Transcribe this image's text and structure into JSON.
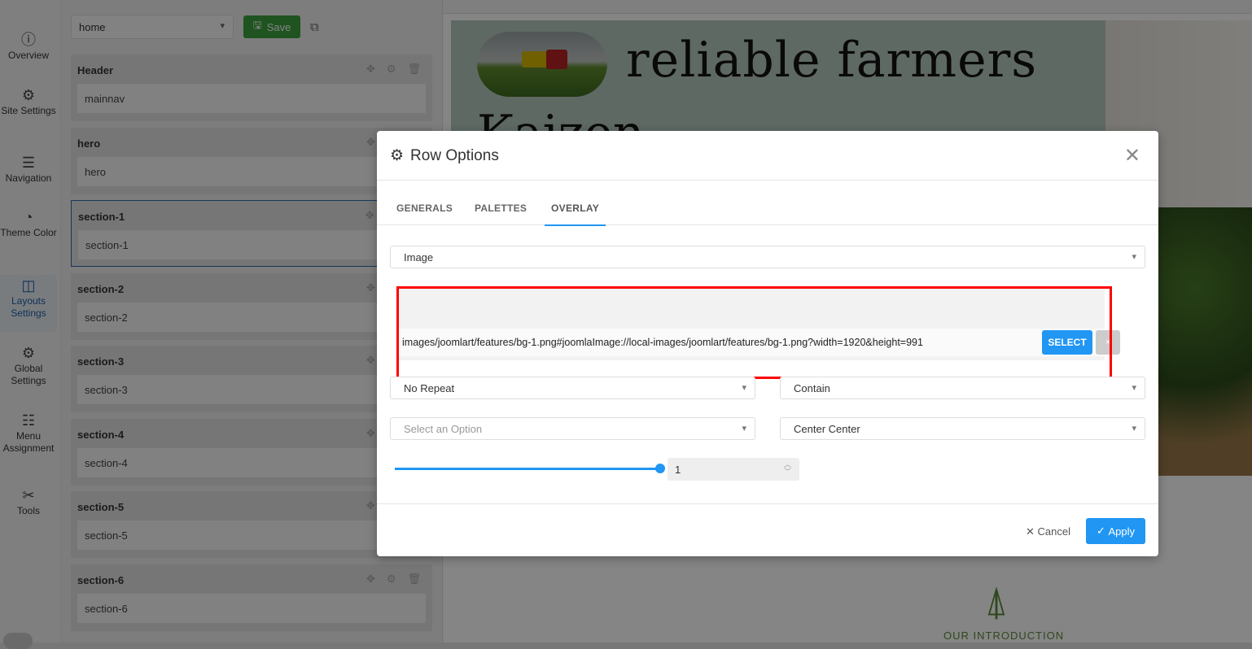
{
  "rail": [
    {
      "label": "Overview",
      "icon": "info-icon"
    },
    {
      "label": "Site Settings",
      "icon": "gear-icon"
    },
    {
      "label": "Navigation",
      "icon": "menu-icon"
    },
    {
      "label": "Theme Color",
      "icon": "palette-icon"
    },
    {
      "label": "Layouts Settings",
      "icon": "layout-icon",
      "active": true
    },
    {
      "label": "Global Settings",
      "icon": "gears-icon"
    },
    {
      "label": "Menu Assignment",
      "icon": "checklist-icon"
    },
    {
      "label": "Tools",
      "icon": "tools-icon"
    }
  ],
  "toolbar": {
    "layout_value": "home",
    "save_label": "Save"
  },
  "rows": [
    {
      "title": "Header",
      "body": "mainnav"
    },
    {
      "title": "hero",
      "body": "hero"
    },
    {
      "title": "section-1",
      "body": "section-1"
    },
    {
      "title": "section-2",
      "body": "section-2"
    },
    {
      "title": "section-3",
      "body": "section-3"
    },
    {
      "title": "section-4",
      "body": "section-4"
    },
    {
      "title": "section-5",
      "body": "section-5"
    },
    {
      "title": "section-6",
      "body": "section-6"
    }
  ],
  "preview": {
    "hero_title": "reliable farmers",
    "hero_sub": "Kaizen",
    "intro": "OUR INTRODUCTION"
  },
  "modal": {
    "title": "Row Options",
    "tabs": [
      "GENERALS",
      "PALETTES",
      "OVERLAY"
    ],
    "active_tab": "OVERLAY",
    "overlay_type": "Image",
    "image_path": "images/joomlart/features/bg-1.png#joomlaImage://local-images/joomlart/features/bg-1.png?width=1920&height=991",
    "select_label": "SELECT",
    "clear_label": "×",
    "repeat": "No Repeat",
    "size": "Contain",
    "attachment_placeholder": "Select an Option",
    "position": "Center Center",
    "opacity": "1",
    "opacity_fraction": 1,
    "cancel_label": "Cancel",
    "apply_label": "Apply"
  },
  "colors": {
    "accent": "#2196f3",
    "save": "#3ca03c",
    "highlight": "#ff0000"
  }
}
